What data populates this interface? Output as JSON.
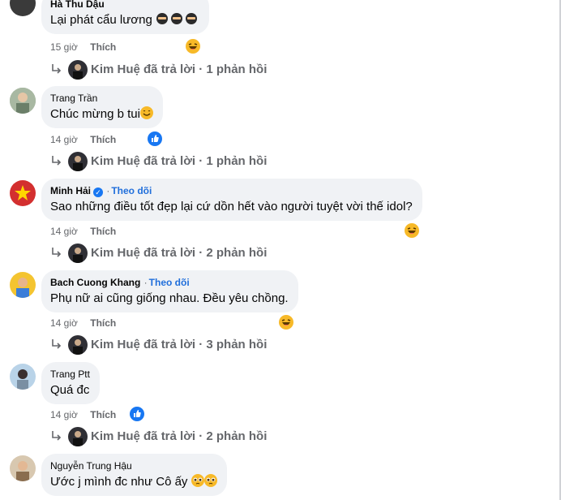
{
  "comments": [
    {
      "name": "Hà Thu Dậu",
      "text": "Lại phát cẩu lương",
      "time": "15 giờ",
      "like": "Thích",
      "reply_author": "Kim Huệ",
      "reply_verb": "đã trả lời",
      "reply_sep": "·",
      "reply_count": "1 phản hồi"
    },
    {
      "name": "Trang Trần",
      "text": "Chúc mừng b tui",
      "time": "14 giờ",
      "like": "Thích",
      "reply_author": "Kim Huệ",
      "reply_verb": "đã trả lời",
      "reply_sep": "·",
      "reply_count": "1 phản hồi"
    },
    {
      "name": "Minh Hải",
      "sep": "·",
      "follow": "Theo dõi",
      "text": "Sao những điều tốt đẹp lại cứ dồn hết vào người tuyệt vời thế idol?",
      "time": "14 giờ",
      "like": "Thích",
      "reply_author": "Kim Huệ",
      "reply_verb": "đã trả lời",
      "reply_sep": "·",
      "reply_count": "2 phản hồi"
    },
    {
      "name": "Bach Cuong Khang",
      "sep": "·",
      "follow": "Theo dõi",
      "text": "Phụ nữ ai cũng giống nhau. Đều yêu chồng.",
      "time": "14 giờ",
      "like": "Thích",
      "reply_author": "Kim Huệ",
      "reply_verb": "đã trả lời",
      "reply_sep": "·",
      "reply_count": "3 phản hồi"
    },
    {
      "name": "Trang Ptt",
      "text": "Quá đc",
      "time": "14 giờ",
      "like": "Thích",
      "reply_author": "Kim Huệ",
      "reply_verb": "đã trả lời",
      "reply_sep": "·",
      "reply_count": "2 phản hồi"
    },
    {
      "name": "Nguyễn Trung Hậu",
      "text": "Ước j mình đc như Cô ấy"
    }
  ],
  "colors": {
    "bubble": "#f0f2f5",
    "meta": "#65676b",
    "follow": "#216fdb",
    "like_blue": "#1877f2",
    "haha_yellow": "#f7b928"
  },
  "icons": {
    "reply": "reply-arrow-icon",
    "like": "like-reaction-icon",
    "haha": "haha-reaction-icon",
    "verified": "verified-badge-icon"
  }
}
